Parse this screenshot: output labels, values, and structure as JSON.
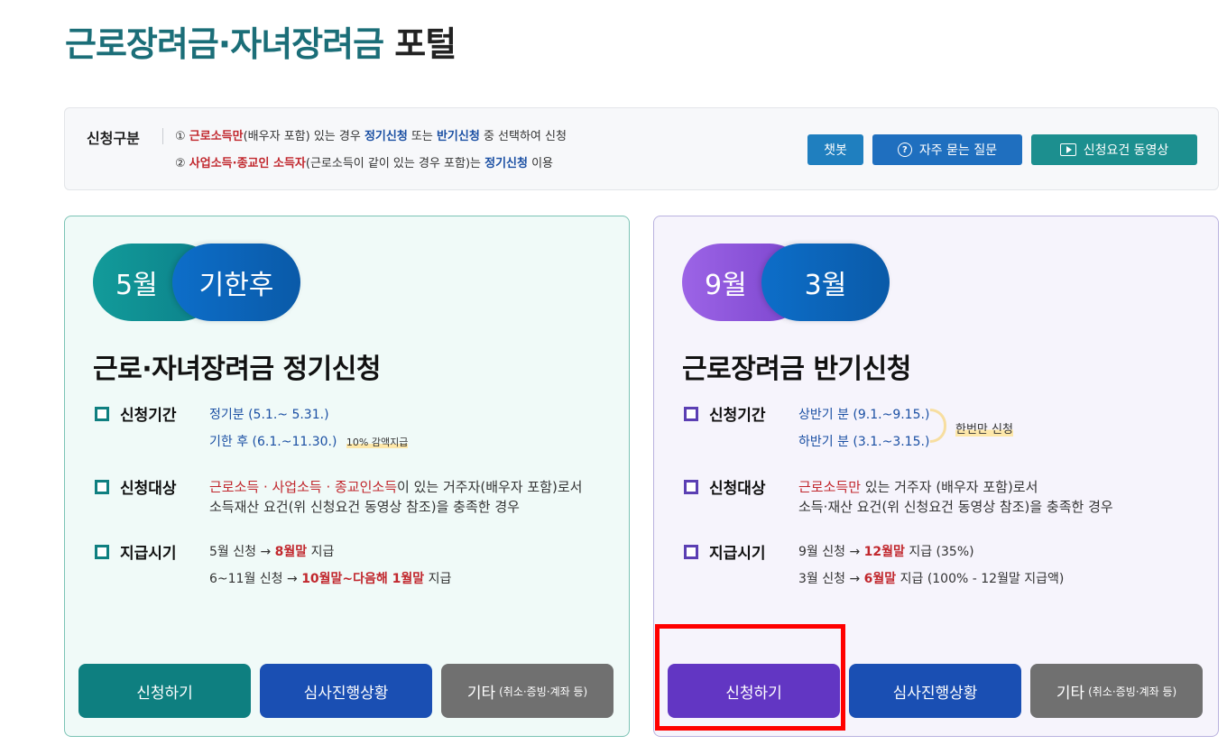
{
  "page_title": {
    "part1": "근로장려금·자녀장려금",
    "part2": " 포털"
  },
  "notice": {
    "label": "신청구분",
    "line1": {
      "num": "①",
      "red": "근로소득만",
      "t1": "(배우자 포함) 있는 경우 ",
      "blue1": "정기신청",
      "t2": " 또는 ",
      "blue2": "반기신청",
      "t3": " 중 선택하여 신청"
    },
    "line2": {
      "num": "②",
      "red": "사업소득·종교인 소득자",
      "t1": "(근로소득이 같이 있는 경우 포함)는 ",
      "blue1": "정기신청",
      "t2": " 이용"
    },
    "buttons": {
      "chatbot": "챗봇",
      "faq": "자주 묻는 질문",
      "video": "신청요건 동영상"
    }
  },
  "card_regular": {
    "pill_a": "5월",
    "pill_b": "기한후",
    "title": "근로·자녀장려금 정기신청",
    "period_label": "신청기간",
    "period_line1": "정기분 (5.1.~ 5.31.)",
    "period_line2": "기한 후 (6.1.~11.30.)",
    "period_note": "10% 감액지급",
    "target_label": "신청대상",
    "target_red": "근로소득 · 사업소득 · 종교인소득",
    "target_t1": "이 있는 거주자(배우자 포함)로서",
    "target_line2": "소득재산 요건(위 신청요건 동영상 참조)을 충족한 경우",
    "pay_label": "지급시기",
    "pay_line1": {
      "t1": "5월 신청 → ",
      "red": "8월말",
      "t2": " 지급"
    },
    "pay_line2": {
      "t1": "6~11월 신청 → ",
      "red": "10월말~다음해 1월말",
      "t2": " 지급"
    },
    "btn_apply": "신청하기",
    "btn_status": "심사진행상황",
    "btn_etc": "기타",
    "btn_etc_small": "(취소·증빙·계좌 등)"
  },
  "card_half": {
    "pill_a": "9월",
    "pill_b": "3월",
    "title": "근로장려금 반기신청",
    "period_label": "신청기간",
    "period_line1": "상반기 분 (9.1.~9.15.)",
    "period_line2": "하반기 분 (3.1.~3.15.)",
    "period_note": "한번만 신청",
    "target_label": "신청대상",
    "target_red": "근로소득만",
    "target_t1": " 있는 거주자 (배우자 포함)로서",
    "target_line2": "소득·재산 요건(위 신청요건 동영상 참조)을 충족한 경우",
    "pay_label": "지급시기",
    "pay_line1": {
      "t1": "9월 신청 → ",
      "red": "12월말",
      "t2": " 지급 (35%)"
    },
    "pay_line2": {
      "t1": "3월 신청 → ",
      "red": "6월말",
      "t2": " 지급 (100% - 12월말 지급액)"
    },
    "btn_apply": "신청하기",
    "btn_status": "심사진행상황",
    "btn_etc": "기타",
    "btn_etc_small": "(취소·증빙·계좌 등)"
  }
}
